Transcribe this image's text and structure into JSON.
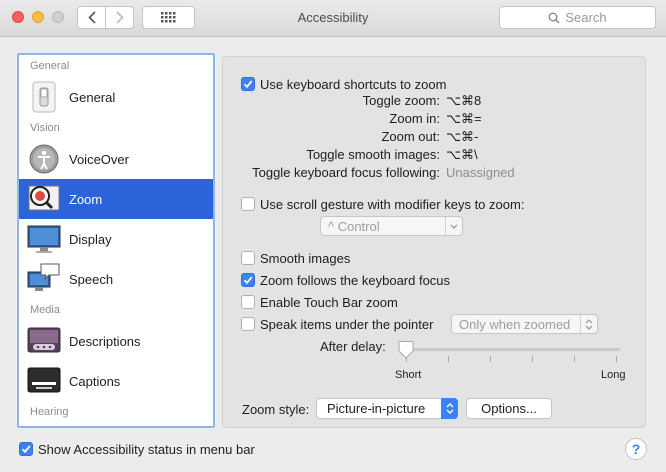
{
  "window": {
    "title": "Accessibility",
    "search_placeholder": "Search"
  },
  "sidebar": {
    "sections": [
      {
        "header": "General",
        "items": [
          {
            "label": "General",
            "icon": "general-switch-icon"
          }
        ]
      },
      {
        "header": "Vision",
        "items": [
          {
            "label": "VoiceOver",
            "icon": "voiceover-icon"
          },
          {
            "label": "Zoom",
            "icon": "zoom-icon",
            "selected": true
          },
          {
            "label": "Display",
            "icon": "display-icon"
          },
          {
            "label": "Speech",
            "icon": "speech-icon"
          }
        ]
      },
      {
        "header": "Media",
        "items": [
          {
            "label": "Descriptions",
            "icon": "descriptions-icon"
          },
          {
            "label": "Captions",
            "icon": "captions-icon"
          }
        ]
      },
      {
        "header": "Hearing",
        "items": []
      }
    ]
  },
  "zoom": {
    "use_shortcuts": {
      "label": "Use keyboard shortcuts to zoom",
      "checked": true
    },
    "shortcuts": [
      {
        "label": "Toggle zoom:",
        "value": "⌥⌘8"
      },
      {
        "label": "Zoom in:",
        "value": "⌥⌘="
      },
      {
        "label": "Zoom out:",
        "value": "⌥⌘-"
      },
      {
        "label": "Toggle smooth images:",
        "value": "⌥⌘\\"
      },
      {
        "label": "Toggle keyboard focus following:",
        "value": "Unassigned"
      }
    ],
    "scroll_gesture": {
      "label": "Use scroll gesture with modifier keys to zoom:",
      "checked": false
    },
    "modifier_popup": "^ Control",
    "smooth_images": {
      "label": "Smooth images",
      "checked": false
    },
    "follow_focus": {
      "label": "Zoom follows the keyboard focus",
      "checked": true
    },
    "touch_bar": {
      "label": "Enable Touch Bar zoom",
      "checked": false
    },
    "speak_items": {
      "label": "Speak items under the pointer",
      "checked": false
    },
    "speak_popup": "Only when zoomed",
    "after_delay": {
      "label": "After delay:",
      "min_label": "Short",
      "max_label": "Long",
      "value": 0
    },
    "zoom_style": {
      "label": "Zoom style:",
      "value": "Picture-in-picture"
    },
    "options_button": "Options..."
  },
  "footer": {
    "status_checkbox": {
      "label": "Show Accessibility status in menu bar",
      "checked": true
    },
    "help_label": "?"
  },
  "colors": {
    "accent": "#3b82f6",
    "selection": "#2b63d9"
  }
}
